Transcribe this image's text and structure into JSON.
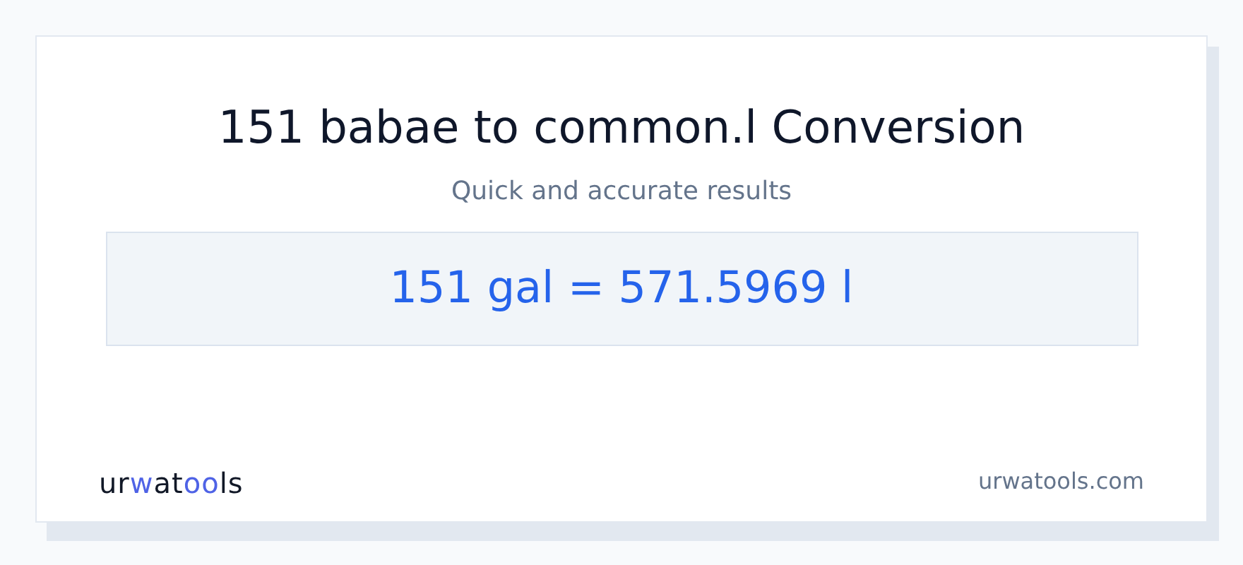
{
  "title": "151 babae to common.l Conversion",
  "subtitle": "Quick and accurate results",
  "result": "151 gal = 571.5969 l",
  "logo": [
    {
      "text": "ur",
      "accent": false
    },
    {
      "text": "w",
      "accent": true
    },
    {
      "text": "at",
      "accent": false
    },
    {
      "text": "oo",
      "accent": true
    },
    {
      "text": "ls",
      "accent": false
    }
  ],
  "site": "urwatools.com"
}
